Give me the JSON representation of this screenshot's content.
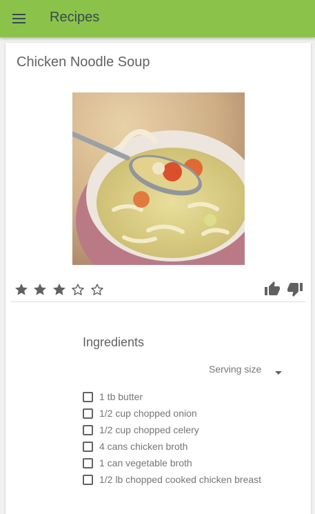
{
  "app": {
    "title": "Recipes"
  },
  "recipe": {
    "title": "Chicken Noodle Soup",
    "rating": 3,
    "max_rating": 5
  },
  "ingredients": {
    "heading": "Ingredients",
    "serving_size_label": "Serving size",
    "items": [
      {
        "label": "1 tb butter",
        "checked": false
      },
      {
        "label": "1/2 cup chopped onion",
        "checked": false
      },
      {
        "label": "1/2 cup chopped celery",
        "checked": false
      },
      {
        "label": "4 cans chicken broth",
        "checked": false
      },
      {
        "label": "1 can vegetable broth",
        "checked": false
      },
      {
        "label": "1/2 lb chopped cooked chicken breast",
        "checked": false
      }
    ]
  },
  "icons": {
    "menu": "menu-icon",
    "star_filled": "star-icon",
    "star_empty": "star-outline-icon",
    "thumb_up": "thumb-up-icon",
    "thumb_down": "thumb-down-icon",
    "dropdown": "chevron-down-icon"
  },
  "colors": {
    "appbar": "#8bc34a",
    "icon": "#616161",
    "text": "#616161"
  }
}
